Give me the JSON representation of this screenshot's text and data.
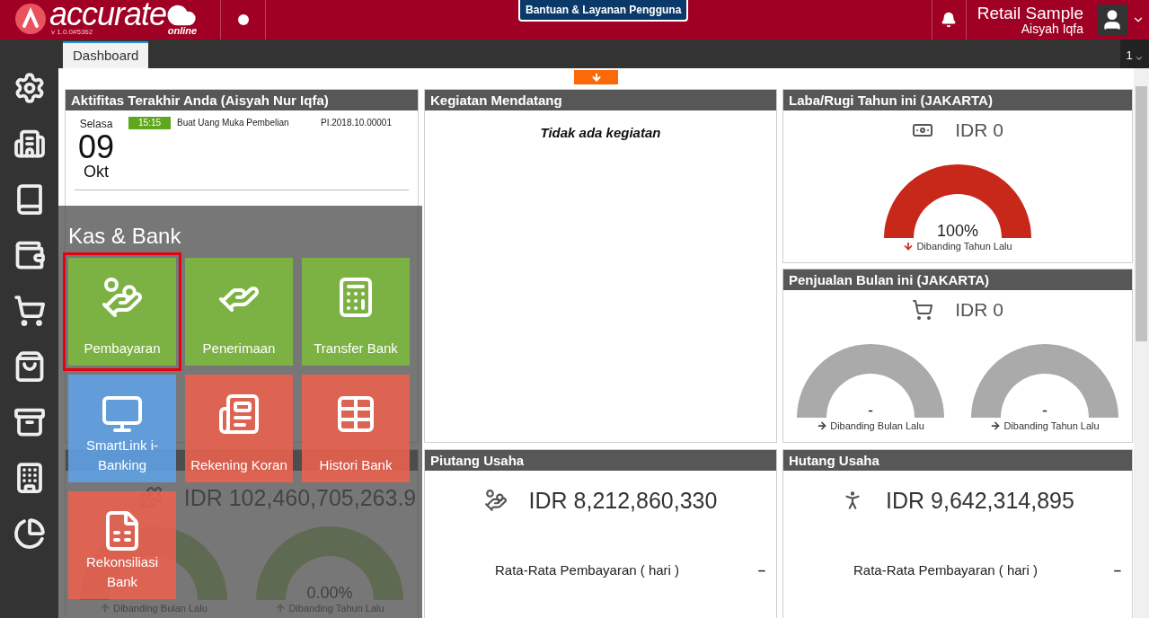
{
  "header": {
    "logo": {
      "name": "accurate",
      "sub": "online",
      "version": "v 1.0.0#5362"
    },
    "help_button": "Bantuan & Layanan Pengguna",
    "company": "Retail Sample",
    "user": "Aisyah Iqfa"
  },
  "tabs": [
    {
      "label": "Dashboard",
      "selected": true
    }
  ],
  "tab_counter": "1",
  "activity": {
    "title": "Aktifitas Terakhir Anda (Aisyah Nur Iqfa)",
    "day": "Selasa",
    "date": "09",
    "month": "Okt",
    "items": [
      {
        "time": "15:15",
        "description": "Buat Uang Muka Pembelian",
        "reference": "PI.2018.10.00001"
      }
    ]
  },
  "upcoming": {
    "title": "Kegiatan Mendatang",
    "empty_text": "Tidak ada kegiatan"
  },
  "profit": {
    "title": "Laba/Rugi Tahun ini (JAKARTA)",
    "amount": "IDR 0",
    "gauges": [
      {
        "value": "100%",
        "caption": "Dibanding Tahun Lalu",
        "kind": "down",
        "color": "#c8281a"
      }
    ]
  },
  "sales": {
    "title": "Penjualan Bulan ini (JAKARTA)",
    "amount": "IDR 0",
    "gauges": [
      {
        "value": "-",
        "caption": "Dibanding Bulan Lalu",
        "kind": "flat",
        "color": "#aaaaaa"
      },
      {
        "value": "-",
        "caption": "Dibanding Tahun Lalu",
        "kind": "flat",
        "color": "#aaaaaa"
      }
    ]
  },
  "assets": {
    "amount": "IDR 102,460,705,263.9",
    "gauges": [
      {
        "caption": "Dibanding Bulan Lalu",
        "kind": "up"
      },
      {
        "value": "0.00%",
        "caption": "Dibanding Tahun Lalu",
        "kind": "up"
      }
    ]
  },
  "receivables": {
    "title": "Piutang Usaha",
    "amount": "IDR 8,212,860,330",
    "metric": "Rata-Rata Pembayaran ( hari )",
    "metric_value": "–"
  },
  "payables": {
    "title": "Hutang Usaha",
    "amount": "IDR 9,642,314,895",
    "metric": "Rata-Rata Pembayaran ( hari )",
    "metric_value": "–"
  },
  "menu": {
    "title": "Kas & Bank",
    "tiles": [
      {
        "label": "Pembayaran",
        "color": "#7cb83d",
        "selected": true
      },
      {
        "label": "Penerimaan",
        "color": "#7cb83d",
        "selected": false
      },
      {
        "label": "Transfer Bank",
        "color": "#7cb83d",
        "selected": false
      },
      {
        "label": "SmartLink i-Banking",
        "color": "#5fa1e3",
        "selected": false
      },
      {
        "label": "Rekening Koran",
        "color": "#e8604f",
        "selected": false
      },
      {
        "label": "Histori Bank",
        "color": "#e8604f",
        "selected": false
      },
      {
        "label": "Rekonsiliasi Bank",
        "color": "#e8604f",
        "selected": false
      }
    ]
  }
}
